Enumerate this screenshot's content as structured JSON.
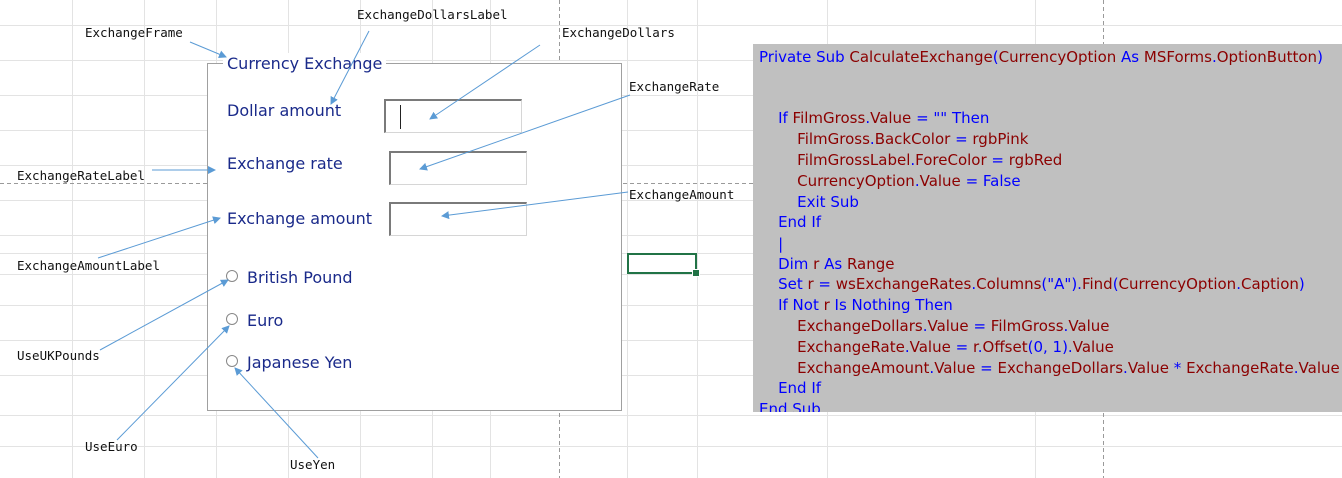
{
  "userform": {
    "frame_caption": "Currency Exchange",
    "labels": {
      "dollar_amount": "Dollar amount",
      "exchange_rate": "Exchange rate",
      "exchange_amount": "Exchange amount"
    },
    "inputs": {
      "exchange_dollars": "",
      "exchange_rate": "",
      "exchange_amount": ""
    },
    "options": [
      "British Pound",
      "Euro",
      "Japanese Yen"
    ]
  },
  "annotations": {
    "exchange_frame": "ExchangeFrame",
    "exchange_dollars_label": "ExchangeDollarsLabel",
    "exchange_dollars": "ExchangeDollars",
    "exchange_rate": "ExchangeRate",
    "exchange_rate_label": "ExchangeRateLabel",
    "exchange_amount": "ExchangeAmount",
    "exchange_amount_label": "ExchangeAmountLabel",
    "use_uk_pounds": "UseUKPounds",
    "use_euro": "UseEuro",
    "use_yen": "UseYen"
  },
  "code_lines": [
    [
      [
        "kw",
        "Private Sub "
      ],
      [
        "id",
        "CalculateExchange"
      ],
      [
        "kw",
        "("
      ],
      [
        "id",
        "CurrencyOption"
      ],
      [
        "kw",
        " As "
      ],
      [
        "id",
        "MSForms"
      ],
      [
        "kw",
        "."
      ],
      [
        "id",
        "OptionButton"
      ],
      [
        "kw",
        ")"
      ]
    ],
    [],
    [
      [
        "kw",
        "    If "
      ],
      [
        "id",
        "FilmGross"
      ],
      [
        "kw",
        "."
      ],
      [
        "id",
        "Value"
      ],
      [
        "kw",
        " = \"\" Then"
      ]
    ],
    [
      [
        "kw",
        "        "
      ],
      [
        "id",
        "FilmGross"
      ],
      [
        "kw",
        "."
      ],
      [
        "id",
        "BackColor"
      ],
      [
        "kw",
        " = "
      ],
      [
        "id",
        "rgbPink"
      ]
    ],
    [
      [
        "kw",
        "        "
      ],
      [
        "id",
        "FilmGrossLabel"
      ],
      [
        "kw",
        "."
      ],
      [
        "id",
        "ForeColor"
      ],
      [
        "kw",
        " = "
      ],
      [
        "id",
        "rgbRed"
      ]
    ],
    [
      [
        "kw",
        "        "
      ],
      [
        "id",
        "CurrencyOption"
      ],
      [
        "kw",
        "."
      ],
      [
        "id",
        "Value"
      ],
      [
        "kw",
        " = False"
      ]
    ],
    [
      [
        "kw",
        "        Exit Sub"
      ]
    ],
    [
      [
        "kw",
        "    End If"
      ]
    ],
    [
      [
        "kw",
        "    |"
      ]
    ],
    [
      [
        "kw",
        "    Dim "
      ],
      [
        "id",
        "r"
      ],
      [
        "kw",
        " As "
      ],
      [
        "id",
        "Range"
      ]
    ],
    [
      [
        "kw",
        "    Set "
      ],
      [
        "id",
        "r"
      ],
      [
        "kw",
        " = "
      ],
      [
        "id",
        "wsExchangeRates"
      ],
      [
        "kw",
        "."
      ],
      [
        "id",
        "Columns"
      ],
      [
        "kw",
        "(\"A\")."
      ],
      [
        "id",
        "Find"
      ],
      [
        "kw",
        "("
      ],
      [
        "id",
        "CurrencyOption"
      ],
      [
        "kw",
        "."
      ],
      [
        "id",
        "Caption"
      ],
      [
        "kw",
        ")"
      ]
    ],
    [
      [
        "kw",
        "    If Not "
      ],
      [
        "id",
        "r"
      ],
      [
        "kw",
        " Is Nothing Then"
      ]
    ],
    [
      [
        "kw",
        "        "
      ],
      [
        "id",
        "ExchangeDollars"
      ],
      [
        "kw",
        "."
      ],
      [
        "id",
        "Value"
      ],
      [
        "kw",
        " = "
      ],
      [
        "id",
        "FilmGross"
      ],
      [
        "kw",
        "."
      ],
      [
        "id",
        "Value"
      ]
    ],
    [
      [
        "kw",
        "        "
      ],
      [
        "id",
        "ExchangeRate"
      ],
      [
        "kw",
        "."
      ],
      [
        "id",
        "Value"
      ],
      [
        "kw",
        " = "
      ],
      [
        "id",
        "r"
      ],
      [
        "kw",
        "."
      ],
      [
        "id",
        "Offset"
      ],
      [
        "kw",
        "(0, 1)."
      ],
      [
        "id",
        "Value"
      ]
    ],
    [
      [
        "kw",
        "        "
      ],
      [
        "id",
        "ExchangeAmount"
      ],
      [
        "kw",
        "."
      ],
      [
        "id",
        "Value"
      ],
      [
        "kw",
        " = "
      ],
      [
        "id",
        "ExchangeDollars"
      ],
      [
        "kw",
        "."
      ],
      [
        "id",
        "Value"
      ],
      [
        "kw",
        " * "
      ],
      [
        "id",
        "ExchangeRate"
      ],
      [
        "kw",
        "."
      ],
      [
        "id",
        "Value"
      ]
    ],
    [
      [
        "kw",
        "    End If"
      ]
    ],
    [],
    [
      [
        "kw",
        "End Sub"
      ]
    ]
  ],
  "colors": {
    "keyword": "#0000ff",
    "identifier": "#8b0000",
    "form_text": "#1a2a8a",
    "code_background": "#c0c0c0",
    "arrow": "#5b9bd5",
    "selected_cell_border": "#217346"
  }
}
